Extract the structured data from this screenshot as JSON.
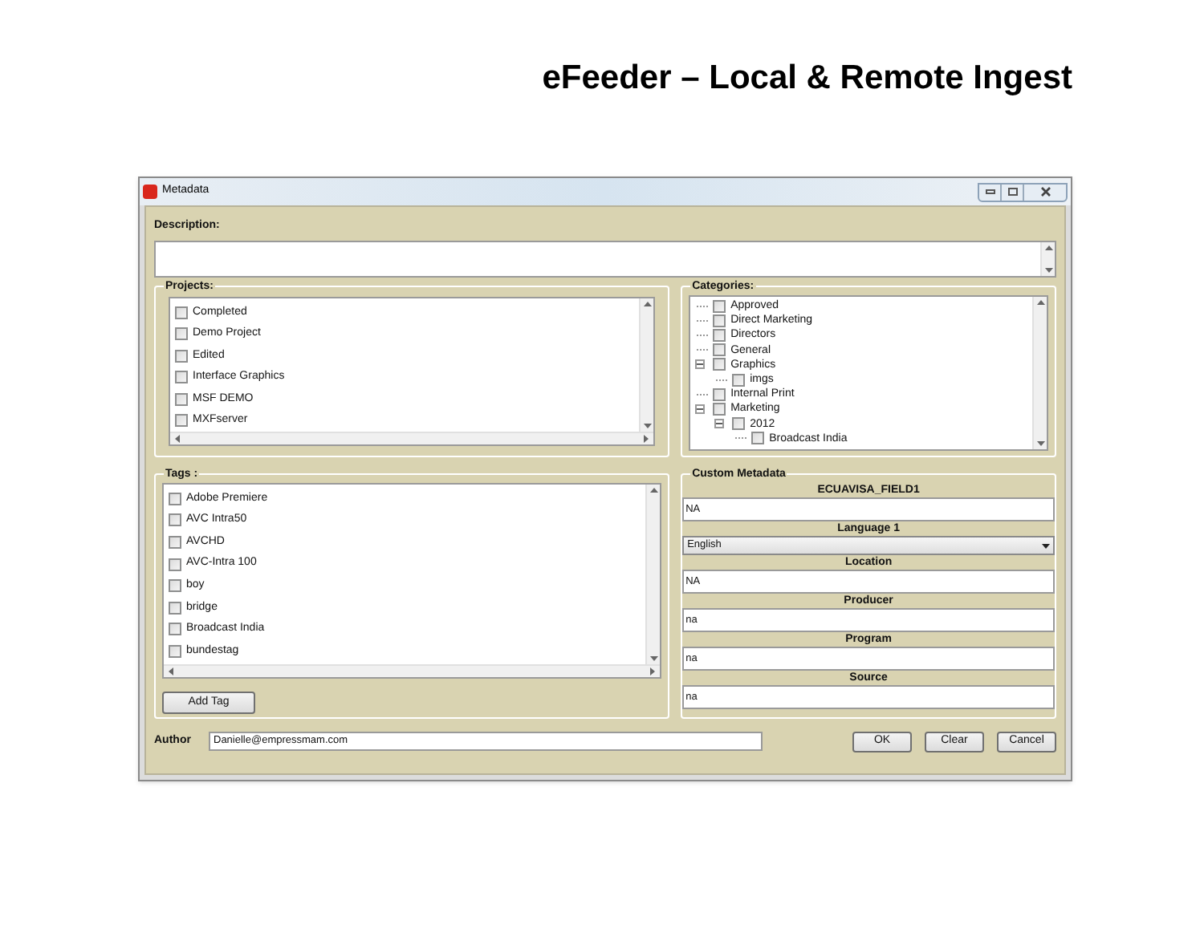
{
  "slide_title": "eFeeder – Local & Remote Ingest",
  "window": {
    "title": "Metadata"
  },
  "description": {
    "label": "Description:"
  },
  "projects": {
    "label": "Projects:",
    "items": [
      {
        "label": "Completed",
        "checked": false
      },
      {
        "label": "Demo Project",
        "checked": false
      },
      {
        "label": "Edited",
        "checked": false
      },
      {
        "label": "Interface Graphics",
        "checked": false
      },
      {
        "label": "MSF DEMO",
        "checked": false
      },
      {
        "label": "MXFserver",
        "checked": false
      }
    ]
  },
  "categories": {
    "label": "Categories:",
    "items": [
      {
        "label": "Approved",
        "checked": false
      },
      {
        "label": "Direct Marketing",
        "checked": false
      },
      {
        "label": "Directors",
        "checked": false
      },
      {
        "label": "General",
        "checked": false
      },
      {
        "label": "Graphics",
        "checked": false,
        "expanded": true,
        "children": [
          {
            "label": "imgs",
            "checked": false
          }
        ]
      },
      {
        "label": "Internal Print",
        "checked": false
      },
      {
        "label": "Marketing",
        "checked": false,
        "expanded": true,
        "children": [
          {
            "label": "2012",
            "checked": false,
            "expanded": true,
            "children": [
              {
                "label": "Broadcast India",
                "checked": false
              }
            ]
          }
        ]
      }
    ]
  },
  "tags": {
    "label": "Tags :",
    "items": [
      {
        "label": "Adobe Premiere",
        "checked": false
      },
      {
        "label": "AVC Intra50",
        "checked": false
      },
      {
        "label": "AVCHD",
        "checked": false
      },
      {
        "label": "AVC-Intra 100",
        "checked": false
      },
      {
        "label": "boy",
        "checked": false
      },
      {
        "label": "bridge",
        "checked": false
      },
      {
        "label": "Broadcast India",
        "checked": false
      },
      {
        "label": "bundestag",
        "checked": false
      }
    ],
    "add_button": "Add Tag"
  },
  "custom_metadata": {
    "label": "Custom Metadata",
    "fields": [
      {
        "kind": "text",
        "label": "ECUAVISA_FIELD1",
        "value": "NA"
      },
      {
        "kind": "dropdown",
        "label": "Language 1",
        "value": "English"
      },
      {
        "kind": "text",
        "label": "Location",
        "value": "NA"
      },
      {
        "kind": "text",
        "label": "Producer",
        "value": "na"
      },
      {
        "kind": "text",
        "label": "Program",
        "value": "na"
      },
      {
        "kind": "text",
        "label": "Source",
        "value": "na"
      }
    ]
  },
  "author": {
    "label": "Author",
    "value": "Danielle@empressmam.com"
  },
  "buttons": [
    "OK",
    "Clear",
    "Cancel"
  ]
}
